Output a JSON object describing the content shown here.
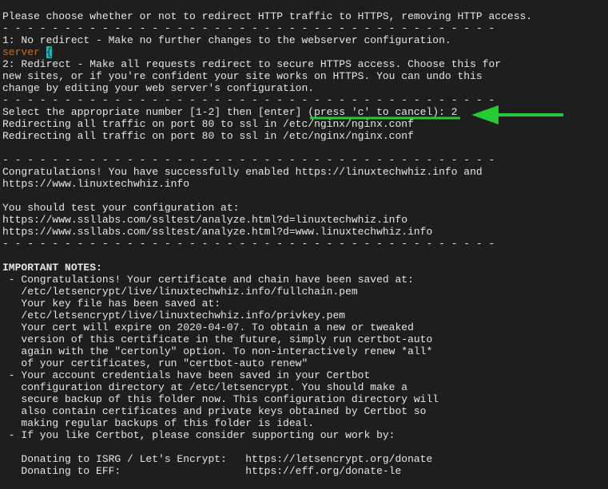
{
  "terminal": {
    "lines": [
      "Please choose whether or not to redirect HTTP traffic to HTTPS, removing HTTP access.",
      "- - - - - - - - - - - - - - - - - - - - - - - - - - - - - - - - - - - - - - - -",
      "1: No redirect - Make no further changes to the webserver configuration.",
      "",
      "2: Redirect - Make all requests redirect to secure HTTPS access. Choose this for",
      "new sites, or if you're confident your site works on HTTPS. You can undo this",
      "change by editing your web server's configuration.",
      "- - - - - - - - - - - - - - - - - - - - - - - - - - - - - - - - - - - - - - - -",
      "Select the appropriate number [1-2] then [enter] (press 'c' to cancel): 2",
      "Redirecting all traffic on port 80 to ssl in /etc/nginx/nginx.conf",
      "Redirecting all traffic on port 80 to ssl in /etc/nginx/nginx.conf",
      "",
      "- - - - - - - - - - - - - - - - - - - - - - - - - - - - - - - - - - - - - - - -",
      "Congratulations! You have successfully enabled https://linuxtechwhiz.info and",
      "https://www.linuxtechwhiz.info",
      "",
      "You should test your configuration at:",
      "https://www.ssllabs.com/ssltest/analyze.html?d=linuxtechwhiz.info",
      "https://www.ssllabs.com/ssltest/analyze.html?d=www.linuxtechwhiz.info",
      "- - - - - - - - - - - - - - - - - - - - - - - - - - - - - - - - - - - - - - - -",
      "",
      "IMPORTANT NOTES:",
      " - Congratulations! Your certificate and chain have been saved at:",
      "   /etc/letsencrypt/live/linuxtechwhiz.info/fullchain.pem",
      "   Your key file has been saved at:",
      "   /etc/letsencrypt/live/linuxtechwhiz.info/privkey.pem",
      "   Your cert will expire on 2020-04-07. To obtain a new or tweaked",
      "   version of this certificate in the future, simply run certbot-auto",
      "   again with the \"certonly\" option. To non-interactively renew *all*",
      "   of your certificates, run \"certbot-auto renew\"",
      " - Your account credentials have been saved in your Certbot",
      "   configuration directory at /etc/letsencrypt. You should make a",
      "   secure backup of this folder now. This configuration directory will",
      "   also contain certificates and private keys obtained by Certbot so",
      "   making regular backups of this folder is ideal.",
      " - If you like Certbot, please consider supporting our work by:",
      "",
      "   Donating to ISRG / Let's Encrypt:   https://letsencrypt.org/donate",
      "   Donating to EFF:                    https://eff.org/donate-le"
    ],
    "server_line": {
      "text": "server ",
      "cursor": "{"
    },
    "colors": {
      "background": "#1e1e1e",
      "text": "#e6e6e6",
      "highlight": "#c5701c",
      "cursor": "#1fb5b5",
      "annotation": "#22cc33"
    },
    "annotation": "arrow pointing to selected option 2"
  }
}
